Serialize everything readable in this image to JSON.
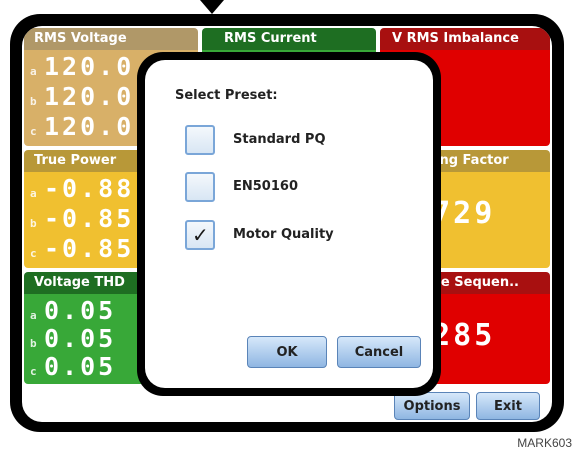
{
  "tiles": {
    "rms_voltage": {
      "title": "RMS Voltage",
      "rows": [
        {
          "phase": "a",
          "value": "120.0"
        },
        {
          "phase": "b",
          "value": "120.0"
        },
        {
          "phase": "c",
          "value": "120.0"
        }
      ]
    },
    "rms_current": {
      "title": "RMS Current"
    },
    "v_rms_imbalance": {
      "title": "V RMS Imbalance"
    },
    "true_power": {
      "title": "True Power",
      "rows": [
        {
          "phase": "a",
          "value": "-0.88"
        },
        {
          "phase": "b",
          "value": "-0.85"
        },
        {
          "phase": "c",
          "value": "-0.85"
        }
      ]
    },
    "derating_factor": {
      "title": "Derating Factor",
      "value": "0.729"
    },
    "voltage_thd": {
      "title": "Voltage THD",
      "rows": [
        {
          "phase": "a",
          "value": "0.05"
        },
        {
          "phase": "b",
          "value": "0.05"
        },
        {
          "phase": "c",
          "value": "0.05"
        }
      ]
    },
    "negative_sequence": {
      "title": "Negative Sequen..",
      "value": "0.285"
    }
  },
  "bottom": {
    "options_label": "Options",
    "exit_label": "Exit"
  },
  "dialog": {
    "title": "Select Preset:",
    "options": [
      {
        "label": "Standard PQ",
        "checked": false
      },
      {
        "label": "EN50160",
        "checked": false
      },
      {
        "label": "Motor Quality",
        "checked": true
      }
    ],
    "ok_label": "OK",
    "cancel_label": "Cancel"
  },
  "watermark": "MARK603",
  "colors": {
    "tan": "#d8b068",
    "green": "#38a838",
    "red": "#e00000",
    "yellow": "#f0c030",
    "button": "#8fb6e2"
  }
}
